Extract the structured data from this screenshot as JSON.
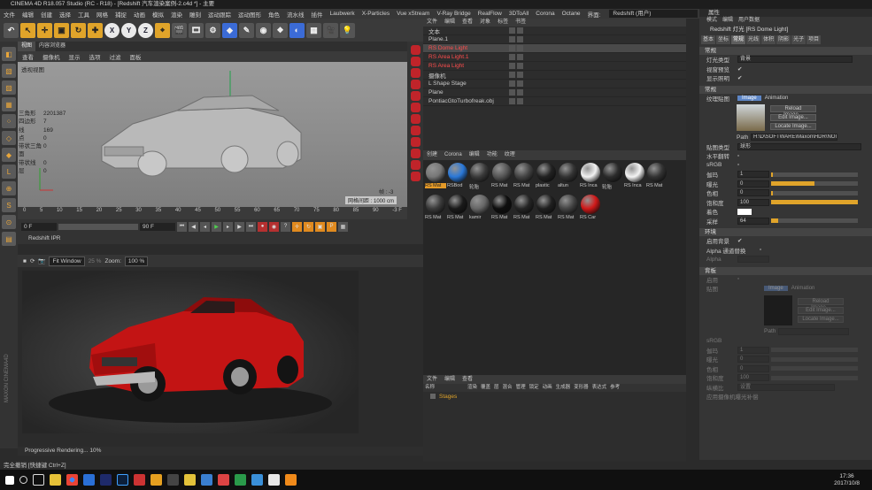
{
  "window": {
    "title": "CINEMA 4D R18.057 Studio (RC - R18) - [Redshift 汽车渲染案例-2.c4d *] - 主要"
  },
  "menu": [
    "文件",
    "编辑",
    "创建",
    "选择",
    "工具",
    "网格",
    "捕捉",
    "动画",
    "模拟",
    "渲染",
    "雕刻",
    "运动跟踪",
    "运动图形",
    "角色",
    "流水线",
    "插件",
    "Laubwerk",
    "X-Particles",
    "Vue xStream",
    "V-Ray Bridge",
    "RealFlow",
    "3DToAll",
    "Corona",
    "Octane"
  ],
  "layout": {
    "label": "界面:",
    "value": "Redshift (用户)"
  },
  "toolbar": {
    "undo": "↶",
    "axes": [
      "X",
      "Y",
      "Z"
    ]
  },
  "viewport": {
    "tabs": [
      "视图",
      "内容浏览器"
    ],
    "menu": [
      "查看",
      "摄像机",
      "显示",
      "选项",
      "过滤",
      "面板"
    ],
    "label": "透视视图",
    "stats": [
      {
        "k": "三角形",
        "v": "2201387"
      },
      {
        "k": "四边形",
        "v": "7"
      },
      {
        "k": "线",
        "v": "169"
      },
      {
        "k": "点",
        "v": "0"
      },
      {
        "k": "带状三角面",
        "v": "0"
      },
      {
        "k": "带状线",
        "v": "0"
      },
      {
        "k": "层",
        "v": "0"
      }
    ],
    "grid": "网格间距 : 1000 cm",
    "frame_marker": "帧 : -3"
  },
  "timeline": {
    "ticks": [
      "0",
      "5",
      "10",
      "15",
      "20",
      "25",
      "30",
      "35",
      "40",
      "45",
      "50",
      "55",
      "60",
      "65",
      "70",
      "75",
      "80",
      "85",
      "90"
    ],
    "end": "-3 F"
  },
  "playback": {
    "start": "0 F",
    "end": "90 F"
  },
  "ipr": {
    "title": "Redshift IPR",
    "fit": "Fit Window",
    "zoom_label": "Zoom:",
    "zoom_pct": "25 %",
    "zoom": "100 %",
    "progress": "Progressive Rendering... 10%"
  },
  "status": "完全撤销 [快捷键 Ctrl+Z]",
  "objects": {
    "menu": [
      "文件",
      "编辑",
      "查看",
      "对象",
      "标签",
      "书签"
    ],
    "rows": [
      {
        "name": "文本",
        "red": false
      },
      {
        "name": "Plane.1",
        "red": false
      },
      {
        "name": "RS Dome Light",
        "red": true,
        "sel": true
      },
      {
        "name": "RS Area Light.1",
        "red": true
      },
      {
        "name": "RS Area Light",
        "red": true
      },
      {
        "name": "摄像机",
        "red": false
      },
      {
        "name": "L Shape Stage",
        "red": false
      },
      {
        "name": "Plane",
        "red": false
      },
      {
        "name": "PontiacGtoTurbofreak.obj",
        "red": false
      }
    ]
  },
  "materials": {
    "menu": [
      "创建",
      "Corona",
      "编辑",
      "功能",
      "纹理"
    ],
    "items": [
      {
        "name": "RS Mat",
        "c": "#777",
        "sel": true
      },
      {
        "name": "RSBod",
        "c": "#2a78d8"
      },
      {
        "name": "轮胎",
        "c": "#3a3a3a"
      },
      {
        "name": "RS Mat",
        "c": "#555"
      },
      {
        "name": "RS Mat",
        "c": "#444"
      },
      {
        "name": "plastic",
        "c": "#222"
      },
      {
        "name": "altun",
        "c": "#333"
      },
      {
        "name": "RS Inca",
        "c": "#f2f2f2"
      },
      {
        "name": "轮胎",
        "c": "#2c2c2c"
      },
      {
        "name": "RS Inca",
        "c": "#f4f4f4"
      },
      {
        "name": "RS Mat",
        "c": "#333"
      },
      {
        "name": "RS Mat",
        "c": "#3a3a3a"
      },
      {
        "name": "RS Mat",
        "c": "#1a1a1a"
      },
      {
        "name": "kamir",
        "c": "#666"
      },
      {
        "name": "RS Mat",
        "c": "#0e0e0e"
      },
      {
        "name": "RS Mat",
        "c": "#252525"
      },
      {
        "name": "RS Mat",
        "c": "#202020"
      },
      {
        "name": "RS Mat",
        "c": "#444"
      },
      {
        "name": "RS Car",
        "c": "#d01818"
      }
    ]
  },
  "takes": {
    "menu": [
      "文件",
      "编辑",
      "查看"
    ],
    "cols": [
      "名称",
      "渲染",
      "覆盖",
      "层",
      "混合",
      "管理",
      "锁定",
      "动画",
      "生成器",
      "变形器",
      "表达式",
      "参考"
    ],
    "row": "Stages"
  },
  "attr": {
    "header": "属性",
    "menu": [
      "模式",
      "编辑",
      "用户数据"
    ],
    "title": "Redshift 灯光 [RS Dome Light]",
    "tabs": [
      "基本",
      "坐标",
      "常规",
      "光线",
      "体积",
      "阴影",
      "光子",
      "项目"
    ],
    "common": "常规",
    "light_type_label": "灯光类型",
    "light_type": "背景",
    "viewport_preview": "视窗预览",
    "show_light": "显示照明",
    "general": "常规",
    "tex_label": "纹理贴图",
    "tex_tabs": [
      "Image",
      "Animation"
    ],
    "buttons": [
      "Reload Image...",
      "Edit Image...",
      "Locate Image..."
    ],
    "path_label": "Path",
    "path": "H:\\D\\SOFTWARE\\Maxon\\HDR\\NOI",
    "map_type_label": "贴图类型",
    "map_type": "球形",
    "hflip": "水平翻转",
    "srgb": "sRGB",
    "params": [
      {
        "l": "伽玛",
        "v": "1",
        "f": 0.02
      },
      {
        "l": "曝光",
        "v": "0",
        "f": 0.5
      },
      {
        "l": "色相",
        "v": "0",
        "f": 0.02
      },
      {
        "l": "饱和度",
        "v": "100",
        "f": 1.0
      }
    ],
    "tint_label": "着色",
    "samples_label": "采样",
    "samples": "64",
    "samples_f": 0.08,
    "env": "环境",
    "use_bg": "启用背景",
    "alpha_label": "Alpha 通道替换",
    "alpha": "Alpha",
    "back": "背板",
    "enable": "启用",
    "bg_map": "贴图",
    "gamma_s": "sRGB",
    "bg_params": [
      {
        "l": "伽玛",
        "v": "1"
      },
      {
        "l": "曝光",
        "v": "0"
      },
      {
        "l": "色相",
        "v": "0"
      },
      {
        "l": "饱和度",
        "v": "100"
      }
    ],
    "bg_label": "纵横比",
    "bg_value": "设置",
    "bg_last": "应用摄像机曝光补偿"
  },
  "clock": {
    "time": "17:36",
    "date": "2017/10/8"
  }
}
